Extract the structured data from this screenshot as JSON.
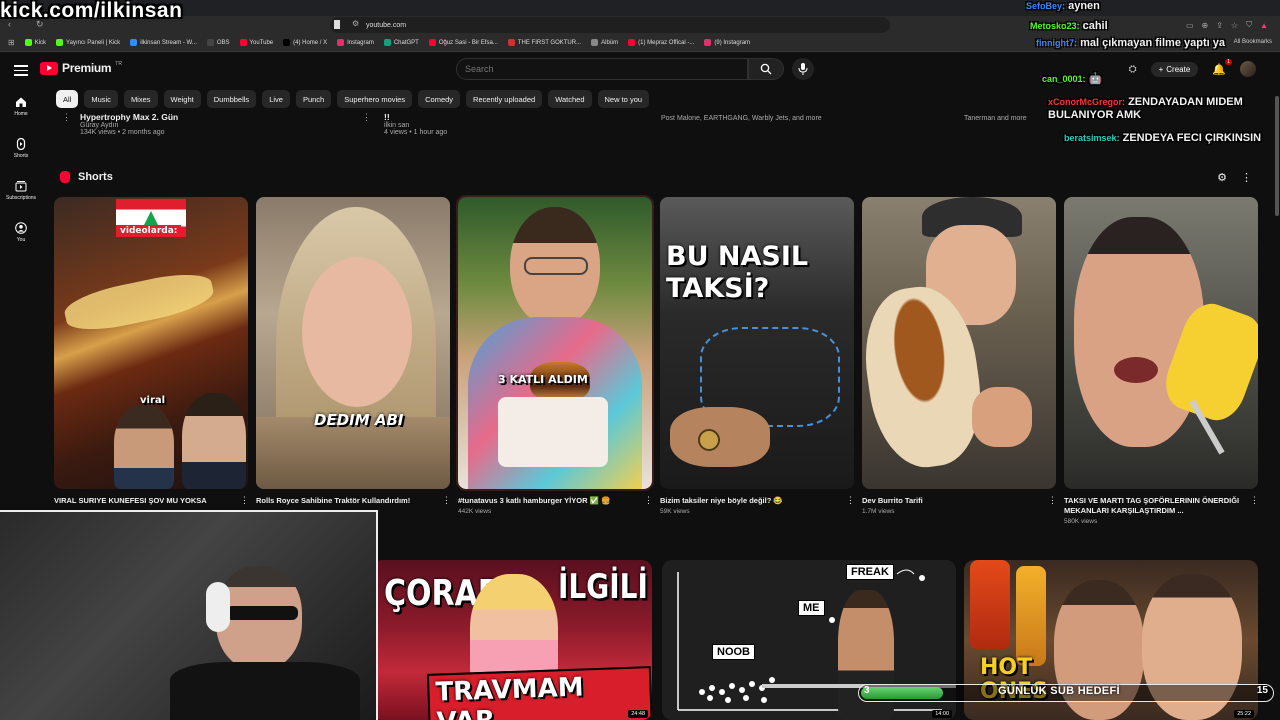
{
  "streamer_tag": "kick.com/ilkinsan",
  "browser": {
    "url": "youtube.com",
    "bookmarks": [
      "Kick",
      "Yayıncı Paneli | Kick",
      "ilkinsan Stream - W...",
      "OBS",
      "YouTube",
      "(4) Home / X",
      "Instagram",
      "ChatGPT",
      "Oğuz Sasi - Bir Efsa...",
      "THE FIRST GOKTUR...",
      "Albüm",
      "(1) Mepraz Offical -...",
      "(9) Instagram"
    ],
    "all_bookmarks": "All Bookmarks",
    "colors": {
      "kick": "#53fc18",
      "youtube": "#ff0033",
      "accent": "#1a73e8"
    }
  },
  "header": {
    "logo_text": "Premium",
    "logo_region": "TR",
    "search_placeholder": "Search",
    "create_label": "Create",
    "notif_count": "1"
  },
  "sidebar": {
    "items": [
      {
        "label": "Home",
        "icon": "home-icon"
      },
      {
        "label": "Shorts",
        "icon": "shorts-icon"
      },
      {
        "label": "Subscriptions",
        "icon": "subscriptions-icon"
      },
      {
        "label": "You",
        "icon": "you-icon"
      }
    ]
  },
  "chips": [
    "All",
    "Music",
    "Mixes",
    "Weight",
    "Dumbbells",
    "Live",
    "Punch",
    "Superhero movies",
    "Comedy",
    "Recently uploaded",
    "Watched",
    "New to you"
  ],
  "previous_row": [
    {
      "title": "Hypertrophy Max 2. Gün",
      "channel": "Güray Aydın",
      "meta": "134K views • 2 months ago"
    },
    {
      "title": "!!",
      "channel": "ilkin san",
      "meta": "4 views • 1 hour ago"
    },
    {
      "title": "",
      "channel": "Post Malone, EARTHGANG, Warbly Jets, and more",
      "meta": ""
    },
    {
      "title": "",
      "channel": "Tanerman and more",
      "meta": ""
    }
  ],
  "shorts": {
    "heading": "Shorts",
    "items": [
      {
        "title": "VIRAL SURIYE KUNEFESI ŞOV MU YOKSA",
        "views": "",
        "overlay": "videolarda:",
        "overlay2": "viral"
      },
      {
        "title": "Rolls Royce Sahibine Traktör Kullandırdım!",
        "views": "",
        "overlay": "DEDIM ABI"
      },
      {
        "title": "#tunatavus 3 katlı hamburger YİYOR ✅ 🍔",
        "views": "442K views",
        "overlay": "3 KATLI ALDIM"
      },
      {
        "title": "Bizim taksiler niye böyle değil? 😂",
        "views": "59K views",
        "overlay": "BU NASIL TAKSİ?"
      },
      {
        "title": "Dev Burrito Tarifi",
        "views": "1.7M views",
        "overlay": ""
      },
      {
        "title": "TAKSI VE MARTI TAG ŞOFÖRLERININ ÖNERDIĞI MEKANLARI KARŞILAŞTIRDIM ...",
        "views": "580K views",
        "overlay": ""
      }
    ]
  },
  "videos": [
    {
      "overlay1": "ÇORAPLA",
      "overlay2": "İLGİLİ",
      "overlay3": "TRAVMAM VAR",
      "duration": "24:48"
    },
    {
      "labels": [
        "FREAK",
        "ME",
        "NOOB"
      ],
      "duration": "14:00"
    },
    {
      "overlay1": "HOT",
      "overlay2": "ONES",
      "duration": "25:22"
    }
  ],
  "chat": [
    {
      "user": "SefoBey:",
      "text": "aynen",
      "color": "#2f8bff"
    },
    {
      "user": "Metosko23:",
      "text": "cahil",
      "color": "#53fc18"
    },
    {
      "user": "finnight7:",
      "text": "mal çıkmayan filme yaptı ya",
      "color": "#2f8bff"
    },
    {
      "user": "can_0001:",
      "text": "🤖",
      "color": "#53fc18"
    },
    {
      "user": "xConorMcGregor:",
      "text": "ZENDAYADAN MIDEM BULANIYOR AMK",
      "color": "#ff3333"
    },
    {
      "user": "beratsimsek:",
      "text": "ZENDEYA FECI ÇIRKINSIN",
      "color": "#1fd1c4"
    }
  ],
  "sub_goal": {
    "current": "3",
    "target": "15",
    "label": "GÜNLÜK SUB HEDEFİ",
    "progress": 0.2
  }
}
